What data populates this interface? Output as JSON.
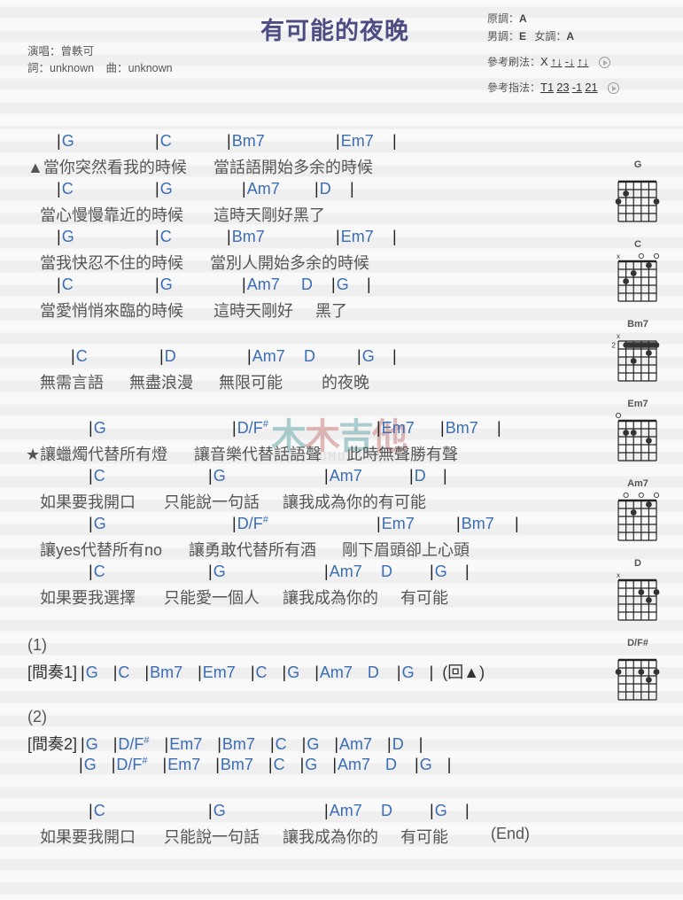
{
  "header": {
    "title": "有可能的夜晚",
    "singer_label": "演唱：",
    "singer": "曾軼可",
    "lyricist_label": "詞：",
    "lyricist": "unknown",
    "composer_label": "曲：",
    "composer": "unknown",
    "original_key_label": "原調：",
    "original_key": "A",
    "male_key_label": "男調：",
    "male_key": "E",
    "female_key_label": "女調：",
    "female_key": "A",
    "strum_label": "參考刷法：",
    "strum_prefix": "X",
    "strum_groups": [
      "↑↓",
      "-↓",
      "↑↓"
    ],
    "pick_label": "參考指法：",
    "pick_groups": [
      "T1",
      "23",
      "-1",
      "21"
    ]
  },
  "watermark": {
    "brand": [
      "木",
      "木",
      "吉",
      "他"
    ],
    "url": "WWW.MUMUJITA.COM"
  },
  "sheet": {
    "lines": [
      {
        "chords": [
          [
            "G",
            64
          ],
          [
            "C",
            175
          ],
          [
            "Bm7",
            256
          ],
          [
            "Em7",
            379
          ],
          [
            "",
            443
          ]
        ],
        "lyric": [
          [
            "▲當你突然看我的時候",
            31
          ],
          [
            "當話語開始多余的時候",
            241
          ]
        ]
      },
      {
        "chords": [
          [
            "C",
            64
          ],
          [
            "G",
            175
          ],
          [
            "Am7",
            273
          ],
          [
            "D",
            355
          ],
          [
            "",
            395
          ]
        ],
        "lyric": [
          [
            "當心慢慢靠近的時候",
            45
          ],
          [
            "這時天剛好黑了",
            241
          ]
        ]
      },
      {
        "chords": [
          [
            "G",
            64
          ],
          [
            "C",
            175
          ],
          [
            "Bm7",
            256
          ],
          [
            "Em7",
            379
          ],
          [
            "",
            443
          ]
        ],
        "lyric": [
          [
            "當我快忍不住的時候",
            45
          ],
          [
            "當別人開始多余的時候",
            237
          ]
        ]
      },
      {
        "chords": [
          [
            "C",
            64
          ],
          [
            "G",
            175
          ],
          [
            "Am7",
            273
          ],
          [
            "D ",
            340,
            true
          ],
          [
            "G",
            374
          ],
          [
            "",
            414
          ]
        ],
        "lyric": [
          [
            "當愛悄悄來臨的時候",
            45
          ],
          [
            "這時天剛好",
            241
          ],
          [
            "黑了",
            356
          ]
        ]
      },
      {
        "chords": [
          [
            "C",
            80
          ],
          [
            "D",
            180
          ],
          [
            "Am7",
            279
          ],
          [
            "D",
            343,
            true
          ],
          [
            "G",
            403
          ],
          [
            "",
            443
          ]
        ],
        "lyric": [
          [
            "無需言語",
            45
          ],
          [
            "無盡浪漫",
            146
          ],
          [
            "無限可能",
            247
          ],
          [
            "的夜晚",
            363
          ]
        ]
      },
      {
        "chords": [
          [
            "G",
            100
          ],
          [
            "D/F#",
            262
          ],
          [
            "Em7",
            425
          ],
          [
            "Bm7",
            497
          ],
          [
            "",
            561
          ]
        ],
        "lyric": [
          [
            "★讓蠟燭代替所有燈",
            29
          ],
          [
            "讓音樂代替話語聲",
            219
          ],
          [
            "此時無聲勝有聲",
            391
          ]
        ]
      },
      {
        "chords": [
          [
            "C",
            100
          ],
          [
            "G",
            235
          ],
          [
            "Am7",
            366
          ],
          [
            "D",
            462
          ],
          [
            "",
            500
          ]
        ],
        "lyric": [
          [
            "如果要我開口",
            45
          ],
          [
            "只能說一句話",
            185
          ],
          [
            "讓我成為你的有可能",
            319
          ]
        ]
      },
      {
        "chords": [
          [
            "G",
            100
          ],
          [
            "D/F#",
            262
          ],
          [
            "Em7",
            425
          ],
          [
            "Bm7",
            515
          ],
          [
            "",
            581
          ]
        ],
        "lyric": [
          [
            "讓yes代替所有no",
            45
          ],
          [
            "讓勇敢代替所有酒",
            213
          ],
          [
            "剛下眉頭卻上心頭",
            386
          ]
        ]
      },
      {
        "chords": [
          [
            "C",
            100
          ],
          [
            "G",
            235
          ],
          [
            "Am7",
            366
          ],
          [
            "D",
            430,
            true
          ],
          [
            "G",
            485
          ],
          [
            "",
            525
          ]
        ],
        "lyric": [
          [
            "如果要我選擇",
            45
          ],
          [
            "只能愛一個人",
            185
          ],
          [
            "讓我成為你的",
            319
          ],
          [
            "有可能",
            452
          ]
        ]
      }
    ],
    "interlude1": {
      "section": "(1)",
      "label": "[間奏1]",
      "chords": [
        "G",
        "C",
        "Bm7",
        "Em7",
        "C",
        "G",
        "Am7",
        "D",
        "G"
      ],
      "return_mark": "(回▲)"
    },
    "interlude2": {
      "section": "(2)",
      "label": "[間奏2]",
      "row1": [
        "G",
        "D/F#",
        "Em7",
        "Bm7",
        "C",
        "G",
        "Am7",
        "D"
      ],
      "row2": [
        "G",
        "D/F#",
        "Em7",
        "Bm7",
        "C",
        "G",
        "Am7",
        "D",
        "G"
      ]
    },
    "ending": {
      "chords": [
        [
          "C",
          100
        ],
        [
          "G",
          235
        ],
        [
          "Am7",
          366
        ],
        [
          "D",
          430,
          true
        ],
        [
          "G",
          485
        ],
        [
          "",
          525
        ]
      ],
      "lyric": [
        [
          "如果要我開口",
          45
        ],
        [
          "只能說一句話",
          185
        ],
        [
          "讓我成為你的",
          319
        ],
        [
          "有可能",
          452
        ],
        [
          "(End)",
          554
        ]
      ]
    }
  },
  "chord_diagrams": [
    {
      "name": "G",
      "base_fret": null,
      "open": [],
      "muted": [],
      "dots": [
        [
          5,
          2
        ],
        [
          6,
          3
        ],
        [
          1,
          3
        ]
      ],
      "barre": null
    },
    {
      "name": "C",
      "base_fret": null,
      "open": [
        3,
        1
      ],
      "muted": [
        6
      ],
      "dots": [
        [
          2,
          1
        ],
        [
          4,
          2
        ],
        [
          5,
          3
        ]
      ],
      "barre": null
    },
    {
      "name": "Bm7",
      "base_fret": "2",
      "open": [],
      "muted": [
        6
      ],
      "dots": [
        [
          2,
          2
        ],
        [
          4,
          3
        ]
      ],
      "barre": [
        5,
        1,
        1
      ]
    },
    {
      "name": "Em7",
      "base_fret": null,
      "open": [
        6
      ],
      "muted": [],
      "dots": [
        [
          5,
          2
        ],
        [
          4,
          2
        ],
        [
          2,
          3
        ]
      ],
      "barre": null
    },
    {
      "name": "Am7",
      "base_fret": null,
      "open": [
        5,
        3,
        1
      ],
      "muted": [],
      "dots": [
        [
          2,
          1
        ],
        [
          4,
          2
        ]
      ],
      "barre": null
    },
    {
      "name": "D",
      "base_fret": null,
      "open": [],
      "muted": [
        6
      ],
      "dots": [
        [
          3,
          2
        ],
        [
          1,
          2
        ],
        [
          2,
          3
        ]
      ],
      "barre": null
    },
    {
      "name": "D/F#",
      "base_fret": null,
      "open": [],
      "muted": [],
      "dots": [
        [
          6,
          2
        ],
        [
          3,
          2
        ],
        [
          1,
          2
        ],
        [
          2,
          3
        ]
      ],
      "barre": null
    }
  ]
}
